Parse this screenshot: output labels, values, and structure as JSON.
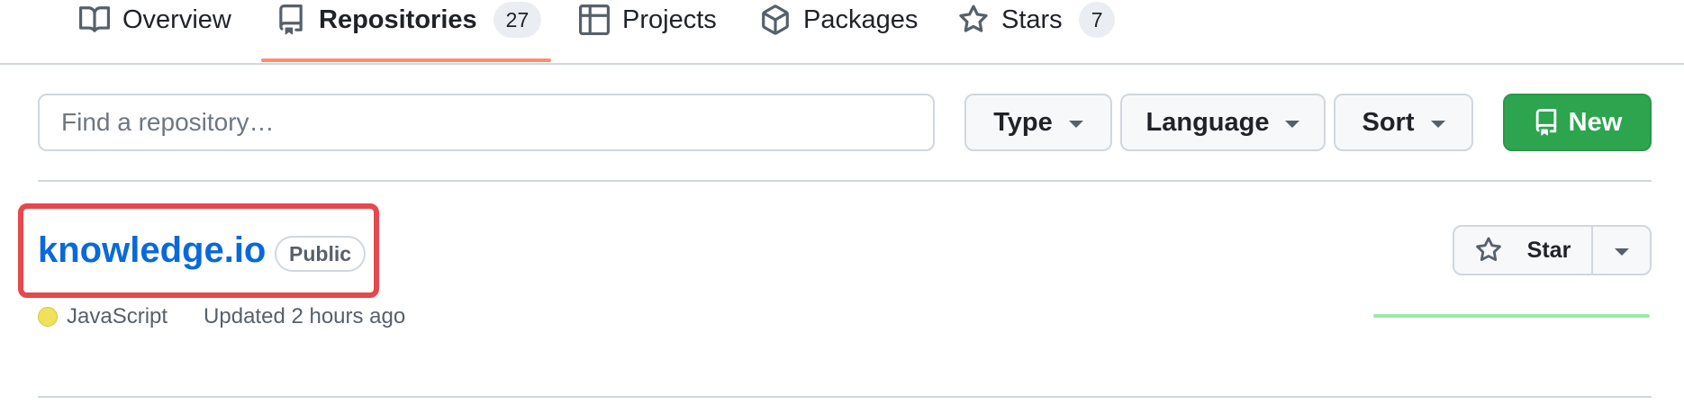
{
  "tabs": [
    {
      "label": "Overview",
      "icon": "book-icon"
    },
    {
      "label": "Repositories",
      "count": "27",
      "icon": "repo-icon",
      "selected": true
    },
    {
      "label": "Projects",
      "icon": "table-icon"
    },
    {
      "label": "Packages",
      "icon": "package-icon"
    },
    {
      "label": "Stars",
      "count": "7",
      "icon": "star-icon"
    }
  ],
  "toolbar": {
    "search_placeholder": "Find a repository…",
    "type_label": "Type",
    "language_label": "Language",
    "sort_label": "Sort",
    "new_label": "New"
  },
  "repo": {
    "name": "knowledge.io",
    "visibility": "Public",
    "language": "JavaScript",
    "language_color": "#f1e05a",
    "updated": "Updated 2 hours ago",
    "star_label": "Star"
  },
  "colors": {
    "accent": "#0969da",
    "new_button": "#2da44e",
    "tab_underline": "#fd8c73",
    "highlight": "#e5484d"
  }
}
